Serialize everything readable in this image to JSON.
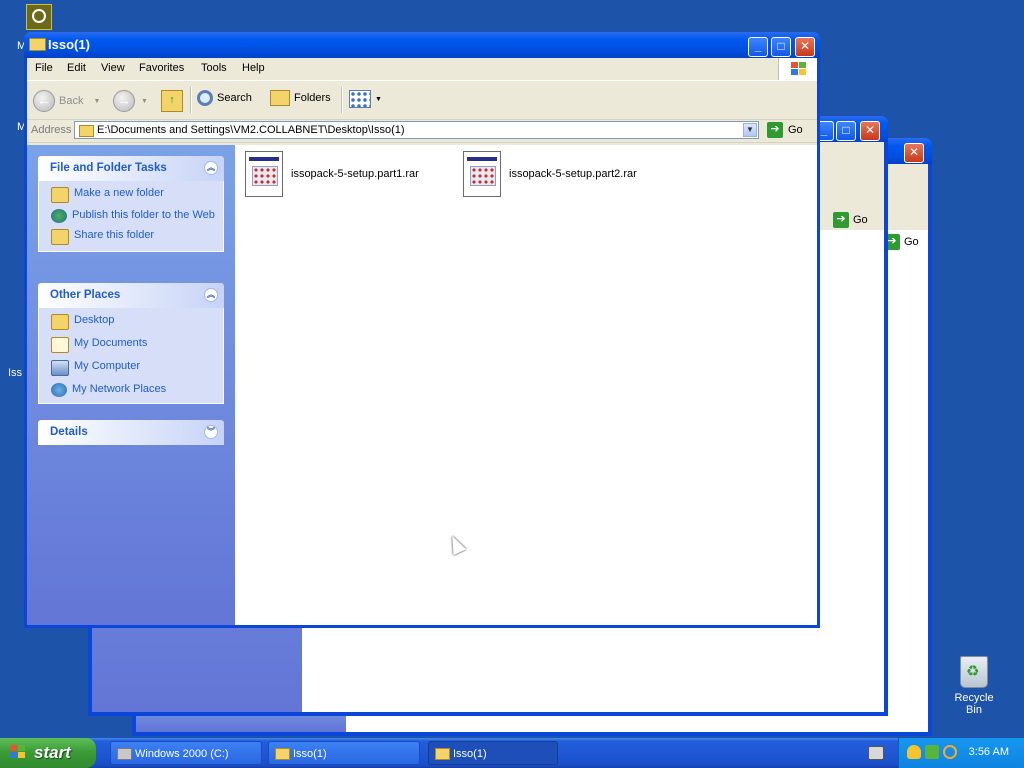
{
  "desktop": {
    "fragments": [
      "M",
      "M",
      "Iss"
    ],
    "recycle_bin_label": "Recycle Bin"
  },
  "background_windows": {
    "go_label": "Go"
  },
  "window": {
    "title": "Isso(1)",
    "menu": [
      "File",
      "Edit",
      "View",
      "Favorites",
      "Tools",
      "Help"
    ],
    "toolbar": {
      "back": "Back",
      "search": "Search",
      "folders": "Folders"
    },
    "address": {
      "label": "Address",
      "value": "E:\\Documents and Settings\\VM2.COLLABNET\\Desktop\\Isso(1)",
      "go": "Go"
    },
    "task_pane": {
      "file_tasks": {
        "title": "File and Folder Tasks",
        "items": [
          "Make a new folder",
          "Publish this folder to the Web",
          "Share this folder"
        ]
      },
      "other_places": {
        "title": "Other Places",
        "items": [
          "Desktop",
          "My Documents",
          "My Computer",
          "My Network Places"
        ]
      },
      "details": {
        "title": "Details"
      }
    },
    "files": [
      {
        "name": "issopack-5-setup.part1.rar"
      },
      {
        "name": "issopack-5-setup.part2.rar"
      }
    ]
  },
  "taskbar": {
    "start": "start",
    "tasks": [
      "Windows 2000 (C:)",
      "Isso(1)",
      "Isso(1)"
    ],
    "clock": "3:56 AM"
  },
  "colors": {
    "desktop": "#1d53a8",
    "titlebar": "#0058ee",
    "link": "#215dc6"
  }
}
